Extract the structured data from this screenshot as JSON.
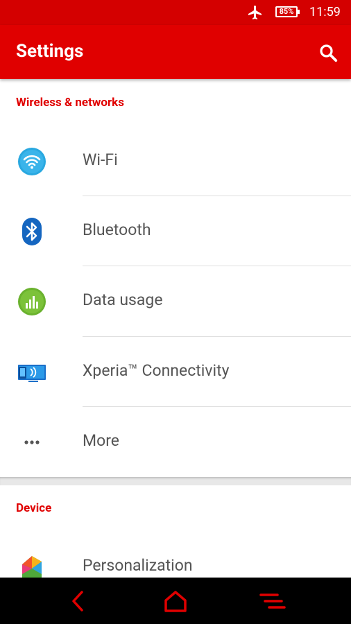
{
  "status_bar": {
    "battery": "85%",
    "time": "11:59",
    "icons": [
      "airplane-mode-icon",
      "battery-icon"
    ]
  },
  "app_bar": {
    "title": "Settings",
    "search_icon": "search-icon"
  },
  "sections": [
    {
      "header": "Wireless & networks",
      "items": [
        {
          "label": "Wi-Fi",
          "icon": "wifi-icon"
        },
        {
          "label": "Bluetooth",
          "icon": "bluetooth-icon"
        },
        {
          "label": "Data usage",
          "icon": "data-usage-icon"
        },
        {
          "label": "Xperia™ Connectivity",
          "icon": "xperia-connectivity-icon"
        },
        {
          "label": "More",
          "icon": "more-icon"
        }
      ]
    },
    {
      "header": "Device",
      "items": [
        {
          "label": "Personalization",
          "icon": "personalization-icon"
        }
      ]
    }
  ],
  "nav_bar": {
    "buttons": [
      "back-icon",
      "home-icon",
      "recents-icon"
    ]
  },
  "colors": {
    "accent": "#e00000",
    "status_bar": "#d40000",
    "label_text": "#555555",
    "nav_bar": "#000000"
  }
}
